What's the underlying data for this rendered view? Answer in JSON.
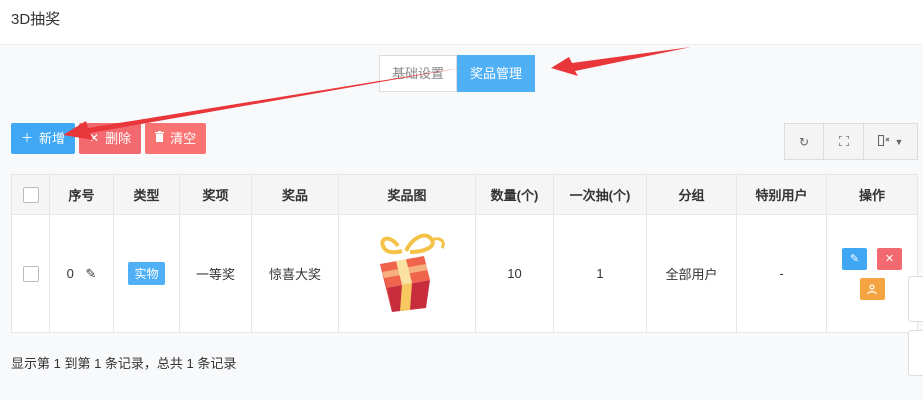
{
  "header": {
    "title": "3D抽奖"
  },
  "tabs": [
    {
      "label": "基础设置",
      "active": false
    },
    {
      "label": "奖品管理",
      "active": true
    }
  ],
  "toolbar": {
    "add_label": "新增",
    "add_icon": "plus-icon",
    "delete_label": "删除",
    "delete_icon": "close-icon",
    "clear_label": "清空",
    "clear_icon": "trash-icon"
  },
  "table_tools": [
    "refresh-icon",
    "fullscreen-icon",
    "columns-icon"
  ],
  "table": {
    "columns": [
      "序号",
      "类型",
      "奖项",
      "奖品",
      "奖品图",
      "数量(个)",
      "一次抽(个)",
      "分组",
      "特别用户",
      "操作"
    ],
    "rows": [
      {
        "index": "0",
        "type": "实物",
        "level": "一等奖",
        "prize": "惊喜大奖",
        "image": "gift-box-image",
        "quantity": "10",
        "per_draw": "1",
        "group": "全部用户",
        "special_user": "-"
      }
    ]
  },
  "footer": {
    "summary": "显示第 1 到第 1 条记录，总共 1 条记录"
  },
  "colors": {
    "primary": "#3fa7f3",
    "danger": "#f26a6f",
    "warning": "#f5a442",
    "annotation_arrow": "#e8363a"
  }
}
